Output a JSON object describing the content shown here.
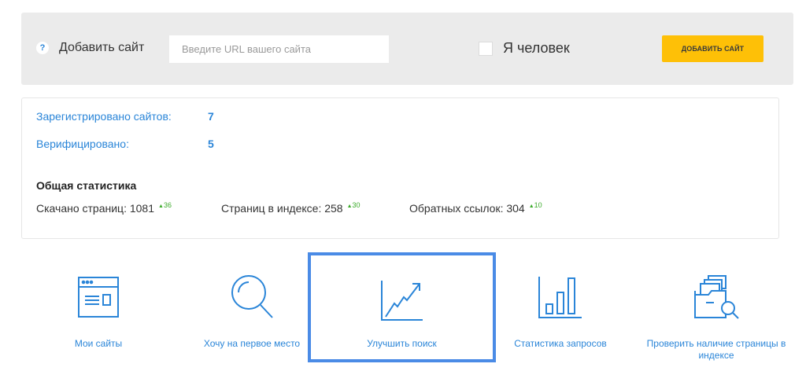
{
  "add_site": {
    "help": "?",
    "label": "Добавить сайт",
    "url_placeholder": "Введите URL вашего сайта",
    "human_label": "Я человек",
    "button_label": "ДОБАВИТЬ САЙТ"
  },
  "stats": {
    "registered_label": "Зарегистрировано сайтов:",
    "registered_value": "7",
    "verified_label": "Верифицировано:",
    "verified_value": "5",
    "general_title": "Общая статистика",
    "metrics": [
      {
        "label": "Скачано страниц: 1081",
        "delta": "36"
      },
      {
        "label": "Страниц в индексе: 258",
        "delta": "30"
      },
      {
        "label": "Обратных ссылок: 304",
        "delta": "10"
      }
    ]
  },
  "tiles": [
    {
      "label": "Мои сайты",
      "icon": "browser-window-icon"
    },
    {
      "label": "Хочу на первое место",
      "icon": "magnifier-icon"
    },
    {
      "label": "Улучшить поиск",
      "icon": "trend-up-icon"
    },
    {
      "label": "Статистика запросов",
      "icon": "bar-chart-icon"
    },
    {
      "label": "Проверить наличие страницы в индексе",
      "icon": "documents-search-icon"
    }
  ],
  "colors": {
    "accent": "#2a85d8",
    "button": "#fec007",
    "positive": "#3cab2b",
    "highlight": "#4a8be6"
  }
}
